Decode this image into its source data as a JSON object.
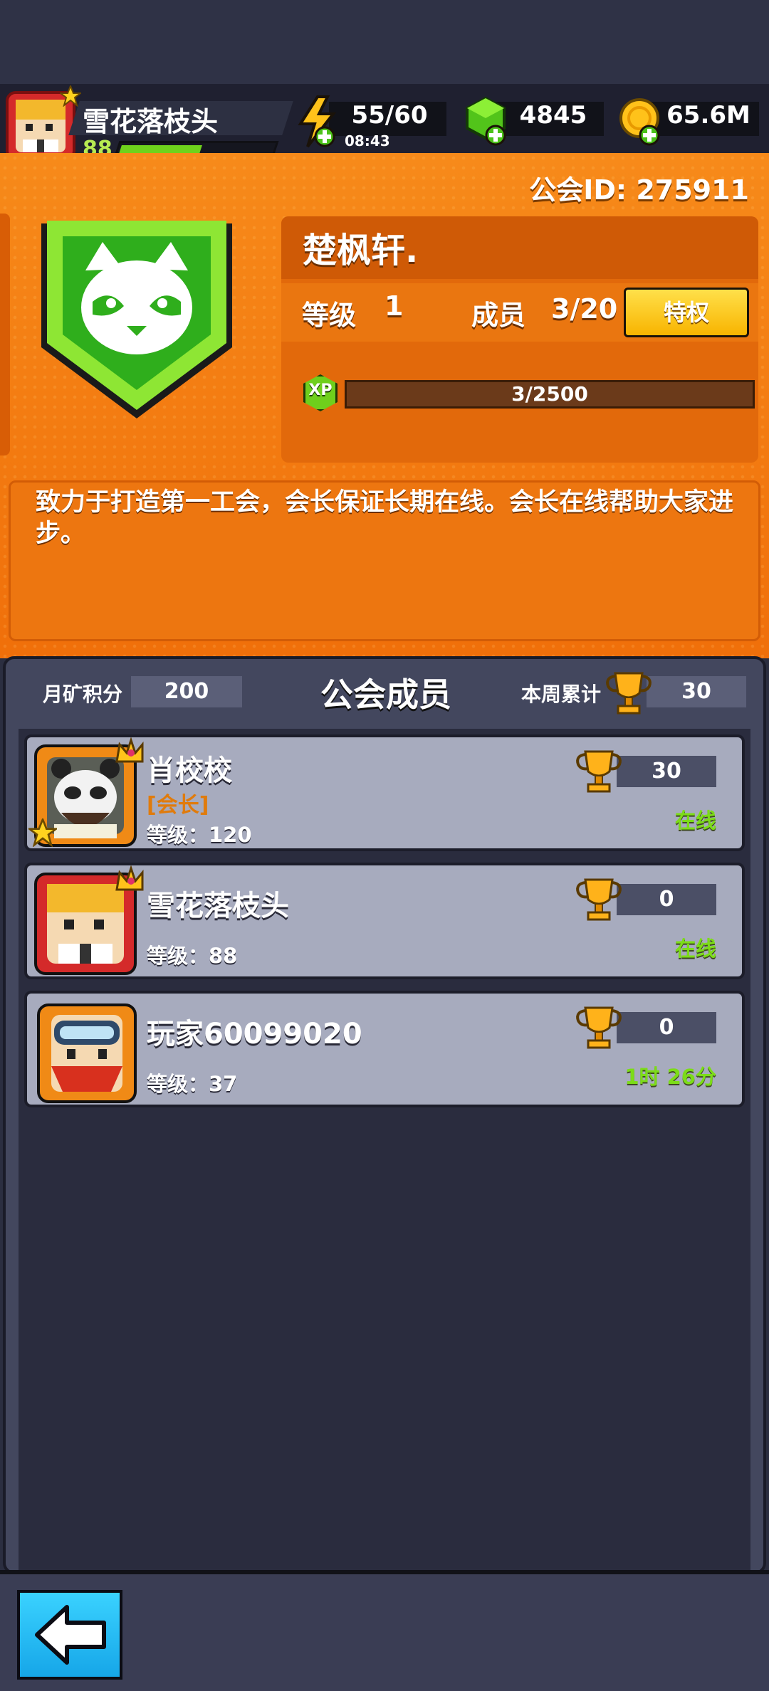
{
  "player": {
    "name": "雪花落枝头",
    "level": "88",
    "level_progress": 0.55
  },
  "resources": {
    "energy": "55/60",
    "energy_timer": "08:43",
    "gems": "4845",
    "coins": "65.6M"
  },
  "guild": {
    "id_label": "公会ID: 275911",
    "name": "楚枫轩.",
    "level_label": "等级",
    "level_value": "1",
    "members_label": "成员",
    "members_value": "3/20",
    "privilege_button": "特权",
    "xp_label": "XP",
    "xp_value": "3/2500",
    "description": "致力于打造第一工会，会长保证长期在线。会长在线帮助大家进步。"
  },
  "members_panel": {
    "title": "公会成员",
    "monthly_label": "月矿积分",
    "monthly_value": "200",
    "weekly_label": "本周累计",
    "weekly_value": "30",
    "members": [
      {
        "name": "肖校校",
        "role": "[会长]",
        "level": "等级：120",
        "score": "30",
        "status": "在线"
      },
      {
        "name": "雪花落枝头",
        "role": "",
        "level": "等级：88",
        "score": "0",
        "status": "在线"
      },
      {
        "name": "玩家60099020",
        "role": "",
        "level": "等级：37",
        "score": "0",
        "status": "1时 26分"
      }
    ]
  },
  "colors": {
    "accent_orange": "#f07a10",
    "online_green": "#7cdc18",
    "badge_green": "#3fbf1c",
    "back_blue": "#1eb6f2"
  },
  "icons": [
    "lightning-icon",
    "gem-icon",
    "coin-icon",
    "panda-emblem-icon",
    "xp-icon",
    "trophy-icon",
    "back-arrow-icon"
  ]
}
